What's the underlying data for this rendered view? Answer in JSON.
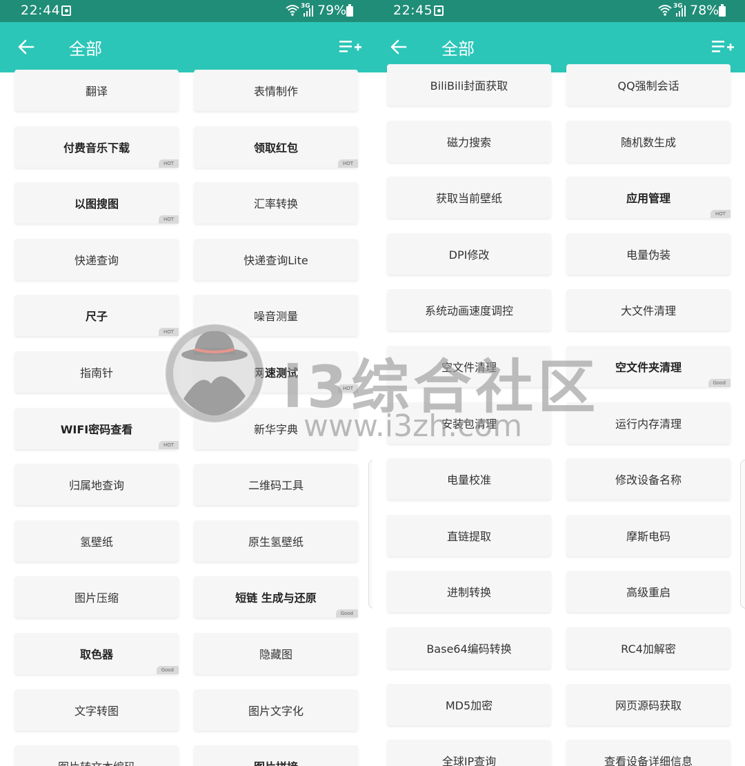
{
  "left": {
    "status": {
      "time": "22:44",
      "network": "3G",
      "battery": "79%"
    },
    "toolbar": {
      "title": "全部"
    },
    "items": [
      {
        "label": "翻译",
        "bold": false,
        "badge": ""
      },
      {
        "label": "表情制作",
        "bold": false,
        "badge": ""
      },
      {
        "label": "付费音乐下载",
        "bold": true,
        "badge": "HOT"
      },
      {
        "label": "领取红包",
        "bold": true,
        "badge": "HOT"
      },
      {
        "label": "以图搜图",
        "bold": true,
        "badge": "HOT"
      },
      {
        "label": "汇率转换",
        "bold": false,
        "badge": ""
      },
      {
        "label": "快递查询",
        "bold": false,
        "badge": ""
      },
      {
        "label": "快递查询Lite",
        "bold": false,
        "badge": ""
      },
      {
        "label": "尺子",
        "bold": true,
        "badge": "HOT"
      },
      {
        "label": "噪音测量",
        "bold": false,
        "badge": ""
      },
      {
        "label": "指南针",
        "bold": false,
        "badge": ""
      },
      {
        "label": "网速测试",
        "bold": true,
        "badge": "HOT"
      },
      {
        "label": "WIFI密码查看",
        "bold": true,
        "badge": "HOT"
      },
      {
        "label": "新华字典",
        "bold": false,
        "badge": ""
      },
      {
        "label": "归属地查询",
        "bold": false,
        "badge": ""
      },
      {
        "label": "二维码工具",
        "bold": false,
        "badge": ""
      },
      {
        "label": "氢壁纸",
        "bold": false,
        "badge": ""
      },
      {
        "label": "原生氢壁纸",
        "bold": false,
        "badge": ""
      },
      {
        "label": "图片压缩",
        "bold": false,
        "badge": ""
      },
      {
        "label": "短链 生成与还原",
        "bold": true,
        "badge": "Good"
      },
      {
        "label": "取色器",
        "bold": true,
        "badge": "Good"
      },
      {
        "label": "隐藏图",
        "bold": false,
        "badge": ""
      },
      {
        "label": "文字转图",
        "bold": false,
        "badge": ""
      },
      {
        "label": "图片文字化",
        "bold": false,
        "badge": ""
      },
      {
        "label": "图片转文本编码",
        "bold": false,
        "badge": ""
      },
      {
        "label": "图片拼接",
        "bold": true,
        "badge": ""
      }
    ]
  },
  "right": {
    "status": {
      "time": "22:45",
      "network": "3G",
      "battery": "78%"
    },
    "toolbar": {
      "title": "全部"
    },
    "items": [
      {
        "label": "BiliBili封面获取",
        "bold": false,
        "badge": ""
      },
      {
        "label": "QQ强制会话",
        "bold": false,
        "badge": ""
      },
      {
        "label": "磁力搜索",
        "bold": false,
        "badge": ""
      },
      {
        "label": "随机数生成",
        "bold": false,
        "badge": ""
      },
      {
        "label": "获取当前壁纸",
        "bold": false,
        "badge": ""
      },
      {
        "label": "应用管理",
        "bold": true,
        "badge": "HOT"
      },
      {
        "label": "DPI修改",
        "bold": false,
        "badge": ""
      },
      {
        "label": "电量伪装",
        "bold": false,
        "badge": ""
      },
      {
        "label": "系统动画速度调控",
        "bold": false,
        "badge": ""
      },
      {
        "label": "大文件清理",
        "bold": false,
        "badge": ""
      },
      {
        "label": "空文件清理",
        "bold": false,
        "badge": ""
      },
      {
        "label": "空文件夹清理",
        "bold": true,
        "badge": "Good"
      },
      {
        "label": "安装包清理",
        "bold": false,
        "badge": ""
      },
      {
        "label": "运行内存清理",
        "bold": false,
        "badge": ""
      },
      {
        "label": "电量校准",
        "bold": false,
        "badge": ""
      },
      {
        "label": "修改设备名称",
        "bold": false,
        "badge": ""
      },
      {
        "label": "直链提取",
        "bold": false,
        "badge": ""
      },
      {
        "label": "摩斯电码",
        "bold": false,
        "badge": ""
      },
      {
        "label": "进制转换",
        "bold": false,
        "badge": ""
      },
      {
        "label": "高级重启",
        "bold": false,
        "badge": ""
      },
      {
        "label": "Base64编码转换",
        "bold": false,
        "badge": ""
      },
      {
        "label": "RC4加解密",
        "bold": false,
        "badge": ""
      },
      {
        "label": "MD5加密",
        "bold": false,
        "badge": ""
      },
      {
        "label": "网页源码获取",
        "bold": false,
        "badge": ""
      },
      {
        "label": "全球IP查询",
        "bold": false,
        "badge": ""
      },
      {
        "label": "查看设备详细信息",
        "bold": false,
        "badge": ""
      }
    ]
  },
  "watermark": {
    "name": "i3综合社区",
    "url": "www.i3zh.com"
  },
  "colors": {
    "toolbar": "#2cc6b8",
    "statusbar": "#1f8d78",
    "card": "#f6f6f6",
    "badge": "#d9d9d9"
  }
}
